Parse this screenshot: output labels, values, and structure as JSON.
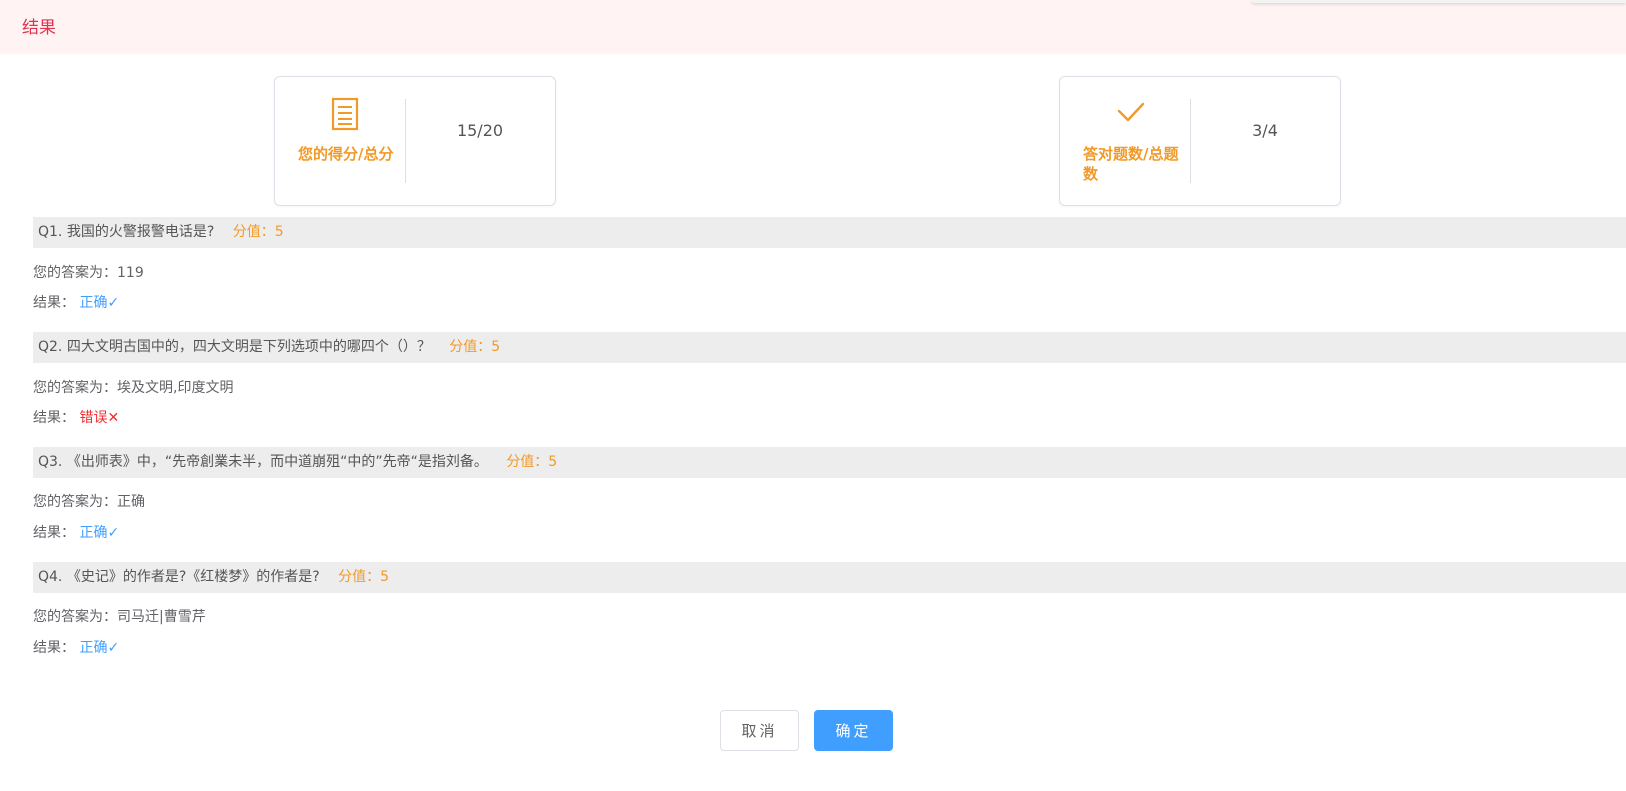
{
  "header": {
    "title": "结果"
  },
  "stats": [
    {
      "icon": "document-list-icon",
      "label": "您的得分/总分",
      "value": "15/20"
    },
    {
      "icon": "checkmark-icon",
      "label": "答对题数/总题数",
      "value": "3/4"
    }
  ],
  "questions": [
    {
      "number": "Q1.",
      "text": "我国的火警报警电话是?",
      "score": "分值：5",
      "answer_prefix": "您的答案为：",
      "answer": "119",
      "result_prefix": "结果：",
      "result": "正确✓",
      "correct": true
    },
    {
      "number": "Q2.",
      "text": "四大文明古国中的，四大文明是下列选项中的哪四个（）？",
      "score": "分值：5",
      "answer_prefix": "您的答案为：",
      "answer": "埃及文明,印度文明",
      "result_prefix": "结果：",
      "result": "错误✕",
      "correct": false
    },
    {
      "number": "Q3.",
      "text": "《出师表》中，“先帝創業未半，而中道崩殂“中的”先帝“是指刘备。",
      "score": "分值：5",
      "answer_prefix": "您的答案为：",
      "answer": "正确",
      "result_prefix": "结果：",
      "result": "正确✓",
      "correct": true
    },
    {
      "number": "Q4.",
      "text": "《史记》的作者是?《红楼梦》的作者是?",
      "score": "分值：5",
      "answer_prefix": "您的答案为：",
      "answer": "司马迁|曹雪芹",
      "result_prefix": "结果：",
      "result": "正确✓",
      "correct": true
    }
  ],
  "buttons": {
    "cancel": "取消",
    "ok": "确定"
  },
  "colors": {
    "accent": "#f19a28",
    "primary": "#409eff",
    "error": "#f02c2c",
    "header_bg": "#fff4f3",
    "header_text": "#e0334f"
  }
}
